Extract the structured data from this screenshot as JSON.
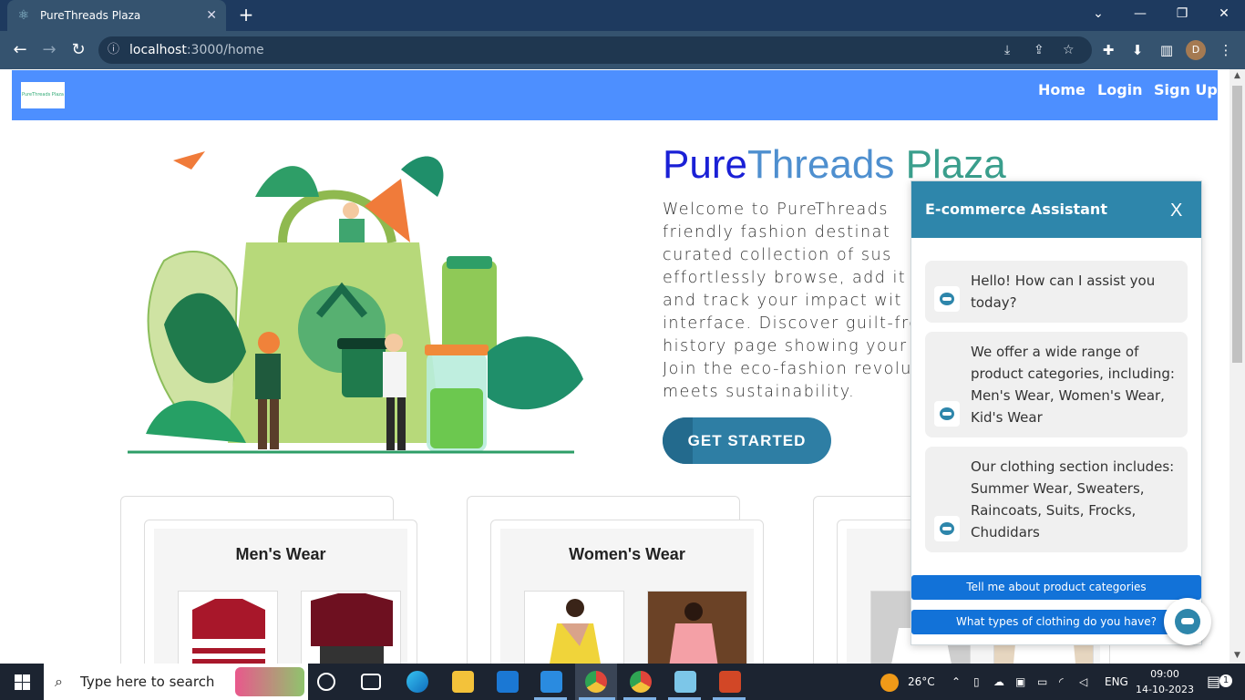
{
  "browser": {
    "tab_title": "PureThreads Plaza",
    "url_host": "localhost",
    "url_path": ":3000/home",
    "profile_initial": "D"
  },
  "site": {
    "logo_text": "PureThreads Plaza",
    "nav": [
      "Home",
      "Login",
      "Sign Up"
    ],
    "hero": {
      "title_parts": [
        "Pure",
        "Threads",
        " Plaza"
      ],
      "text_lines": "Welcome to PureThreads\nfriendly fashion destinat\ncurated collection of sus\neffortlessly browse, add it\nand track your impact wit\ninterface. Discover guilt-fre\nhistory page showing your c\nJoin the eco-fashion revolu\nmeets sustainability.",
      "cta": "GET STARTED"
    },
    "categories": [
      "Men's Wear",
      "Women's Wear",
      ""
    ]
  },
  "chat": {
    "title": "E-commerce Assistant",
    "close_label": "X",
    "messages": [
      "Hello! How can I assist you today?",
      "We offer a wide range of product categories, including: Men's Wear, Women's Wear, Kid's Wear",
      "Our clothing section includes: Summer Wear, Sweaters, Raincoats, Suits, Frocks, Chudidars"
    ],
    "quick_replies": [
      "Tell me about product categories",
      "What types of clothing do you have?"
    ]
  },
  "taskbar": {
    "search_placeholder": "Type here to search",
    "weather": "26°C",
    "language": "ENG",
    "time": "09:00",
    "date": "14-10-2023",
    "notification_count": "1"
  },
  "colors": {
    "site_nav": "#4d8fff",
    "chat_header": "#2e86ab",
    "quick_reply": "#1272d8",
    "cta": "#2e7ea4"
  }
}
